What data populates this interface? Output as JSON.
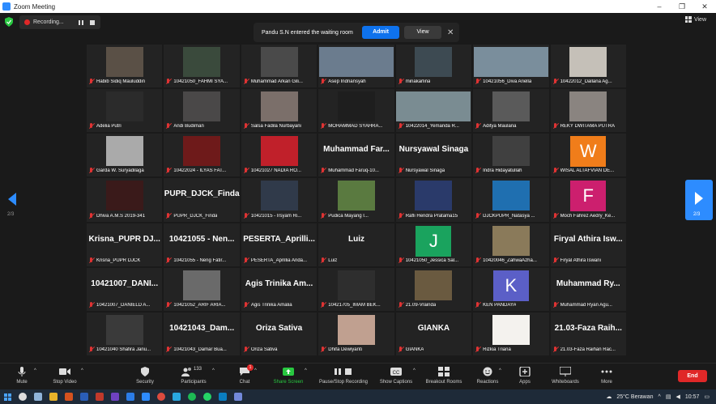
{
  "window": {
    "title": "Zoom Meeting"
  },
  "recording": {
    "label": "Recording..."
  },
  "view_button": {
    "label": "View"
  },
  "waiting_notice": {
    "message": "Pandu S.N entered the waiting room",
    "admit_label": "Admit",
    "view_label": "View"
  },
  "paging": {
    "left": "2/3",
    "right": "2/3"
  },
  "participants": [
    {
      "label": "Habib Sidiq Mauluddin"
    },
    {
      "label": "10421050_FAHMI SYA..."
    },
    {
      "label": "Muhammad Arkan Gili..."
    },
    {
      "label": "Asep Indriansyah"
    },
    {
      "label": "minakarlina"
    },
    {
      "label": "10421056_Diva Ariella"
    },
    {
      "label": "10422012_Dallana Ag..."
    },
    {
      "label": "Adelia Putri"
    },
    {
      "label": "Andi Budiman"
    },
    {
      "label": "Salsa Fadila Nurbayani"
    },
    {
      "label": "MOHAMMAD SYAHRA..."
    },
    {
      "label": "10422014_Yemanda R..."
    },
    {
      "label": "Aditya Maulana"
    },
    {
      "label": "REKY DWITAMA PUTRA"
    },
    {
      "label": "Garda W. Suryadilaga"
    },
    {
      "label": "10422024 - ILYAS FAT..."
    },
    {
      "label": "10421027 NADIA RO..."
    },
    {
      "label": "Muhammad Faruq-10...",
      "big": "Muhammad Far..."
    },
    {
      "label": "Nursyawal Sinaga",
      "big": "Nursyawal Sinaga"
    },
    {
      "label": "Indra Hidayatullah"
    },
    {
      "label": "WISAL ALTAFVIAN DE...",
      "letter": "W"
    },
    {
      "label": "Dhiva A.M.S 2019-341"
    },
    {
      "label": "PUPR_DJCK_Finda",
      "big": "PUPR_DJCK_Finda"
    },
    {
      "label": "10421015 - Irsyam Ri..."
    },
    {
      "label": "Pudica Mayang I..."
    },
    {
      "label": "Rafli Hendra Pratama15"
    },
    {
      "label": "DJCKPUPR_Natasya ..."
    },
    {
      "label": "Moch Fahrez Aedry_Ke...",
      "letter": "F"
    },
    {
      "label": "Krisna_PUPR DJCK",
      "big": "Krisna_PUPR DJ..."
    },
    {
      "label": "10421055 - Neng Fatir...",
      "big": "10421055 - Nen..."
    },
    {
      "label": "PESERTA_Aprillia Anda...",
      "big": "PESERTA_Aprilli..."
    },
    {
      "label": "Luiz",
      "big": "Luiz"
    },
    {
      "label": "10421050_Jessica Sal...",
      "letter": "J"
    },
    {
      "label": "10420046_ZahwaAzha..."
    },
    {
      "label": "Firyal Athira Iswani",
      "big": "Firyal Athira Isw..."
    },
    {
      "label": "10421007_DANIELD A...",
      "big": "10421007_DANI..."
    },
    {
      "label": "10421052_ARIF ARIA..."
    },
    {
      "label": "Agis Trinika Amalia",
      "big": "Agis Trinika Am..."
    },
    {
      "label": "10421705_IMAM BEK..."
    },
    {
      "label": "21.09-Vrainda"
    },
    {
      "label": "KEN PANDAYA",
      "letter": "K"
    },
    {
      "label": "Muhammad Ryan Agu...",
      "big": "Muhammad Ry..."
    },
    {
      "label": "10421040 Shafira Janu..."
    },
    {
      "label": "10421043_Damar Bua...",
      "big": "10421043_Dam..."
    },
    {
      "label": "Oriza Sativa",
      "big": "Oriza Sativa"
    },
    {
      "label": "Dhifa Dewiyanti"
    },
    {
      "label": "GIANKA",
      "big": "GIANKA"
    },
    {
      "label": "Rizkia Triana"
    },
    {
      "label": "21.03-Faza Raihan Rac...",
      "big": "21.03-Faza Raih..."
    }
  ],
  "toolbar": {
    "mute": "Mute",
    "stop_video": "Stop Video",
    "security": "Security",
    "participants": "Participants",
    "participants_count": "133",
    "chat": "Chat",
    "chat_badge": "1",
    "share_screen": "Share Screen",
    "record": "Pause/Stop Recording",
    "captions": "Show Captions",
    "breakout": "Breakout Rooms",
    "reactions": "Reactions",
    "apps": "Apps",
    "whiteboards": "Whiteboards",
    "more": "More",
    "end": "End"
  },
  "taskbar": {
    "weather": "25°C Berawan",
    "time": "10:57"
  },
  "colors": {
    "accent": "#2d8cff",
    "end": "#e02828",
    "share": "#28c840",
    "tile_w": "#f07d1a",
    "tile_f": "#cc1f6e",
    "tile_j": "#1aa35e",
    "tile_k": "#5b5fc7"
  }
}
